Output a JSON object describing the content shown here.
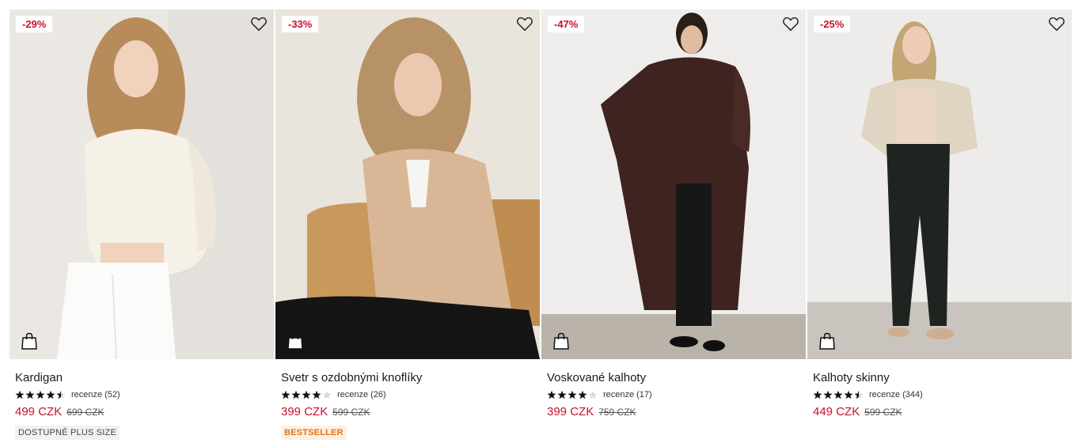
{
  "products": [
    {
      "discount": "-29%",
      "name": "Kardigan",
      "rating": 4.5,
      "reviews_label": "recenze",
      "reviews_count": "(52)",
      "price": "499 CZK",
      "old_price": "699 CZK",
      "tag": "DOSTUPNÉ PLUS SIZE",
      "tag_style": "plus"
    },
    {
      "discount": "-33%",
      "name": "Svetr s ozdobnými knoflíky",
      "rating": 4,
      "reviews_label": "recenze",
      "reviews_count": "(26)",
      "price": "399 CZK",
      "old_price": "599 CZK",
      "tag": "BESTSELLER",
      "tag_style": "best"
    },
    {
      "discount": "-47%",
      "name": "Voskované kalhoty",
      "rating": 4,
      "reviews_label": "recenze",
      "reviews_count": "(17)",
      "price": "399 CZK",
      "old_price": "759 CZK",
      "tag": "",
      "tag_style": ""
    },
    {
      "discount": "-25%",
      "name": "Kalhoty skinny",
      "rating": 4.5,
      "reviews_label": "recenze",
      "reviews_count": "(344)",
      "price": "449 CZK",
      "old_price": "599 CZK",
      "tag": "",
      "tag_style": ""
    }
  ],
  "icons": {
    "favorite": "heart-outline-icon",
    "add_to_cart": "shopping-bag-icon",
    "star": "star-icon"
  },
  "colors": {
    "sale_red": "#c8102e",
    "bestseller_orange": "#e2731b"
  }
}
